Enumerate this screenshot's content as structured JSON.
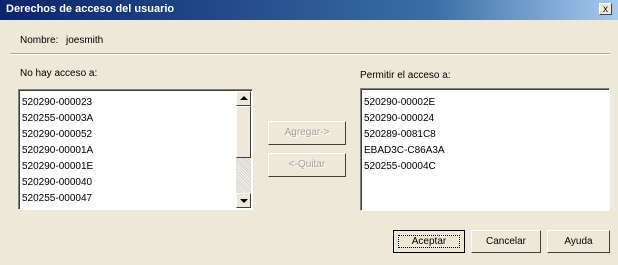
{
  "window": {
    "title": "Derechos de acceso del usuario",
    "close_glyph": "x"
  },
  "user": {
    "name_label": "Nombre:",
    "name_value": "joesmith"
  },
  "left_panel": {
    "label": "No hay acceso a:",
    "items": [
      "520290-000023",
      "520255-00003A",
      "520290-000052",
      "520290-00001A",
      "520290-00001E",
      "520290-000040",
      "520255-000047"
    ]
  },
  "right_panel": {
    "label": "Permitir el acceso a:",
    "items": [
      "520290-00002E",
      "520290-000024",
      "520289-0081C8",
      "EBAD3C-C86A3A",
      "520255-00004C"
    ]
  },
  "transfer": {
    "add_label": "Agregar->",
    "remove_label": "<-Quitar"
  },
  "footer": {
    "accept_label": "Aceptar",
    "cancel_label": "Cancelar",
    "help_label": "Ayuda"
  }
}
